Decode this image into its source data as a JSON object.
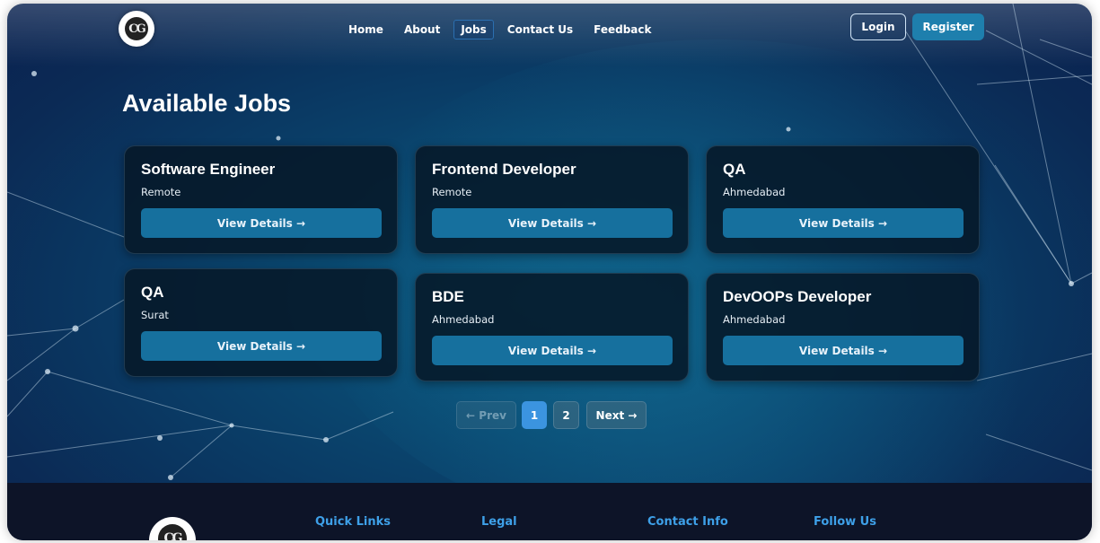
{
  "brand": {
    "logo_text": "CG"
  },
  "nav": {
    "items": [
      "Home",
      "About",
      "Jobs",
      "Contact Us",
      "Feedback"
    ],
    "active": "Jobs"
  },
  "auth": {
    "login_label": "Login",
    "register_label": "Register"
  },
  "page": {
    "title": "Available Jobs"
  },
  "jobs": [
    {
      "title": "Software Engineer",
      "location": "Remote",
      "button": "View Details →"
    },
    {
      "title": "Frontend Developer",
      "location": "Remote",
      "button": "View Details →"
    },
    {
      "title": "QA",
      "location": "Ahmedabad",
      "button": "View Details →"
    },
    {
      "title": "QA",
      "location": "Surat",
      "button": "View Details →"
    },
    {
      "title": "BDE",
      "location": "Ahmedabad",
      "button": "View Details →"
    },
    {
      "title": "DevOOPs Developer",
      "location": "Ahmedabad",
      "button": "View Details →"
    }
  ],
  "pagination": {
    "prev": "← Prev",
    "pages": [
      "1",
      "2"
    ],
    "current": "1",
    "next": "Next →"
  },
  "footer": {
    "columns": [
      "Quick Links",
      "Legal",
      "Contact Info",
      "Follow Us"
    ]
  },
  "colors": {
    "background": "#0a3a64",
    "card": "#061828",
    "button": "#16709e",
    "accent": "#3b94e0",
    "footer": "#0d1428",
    "footer_heading": "#3ea0e8"
  }
}
